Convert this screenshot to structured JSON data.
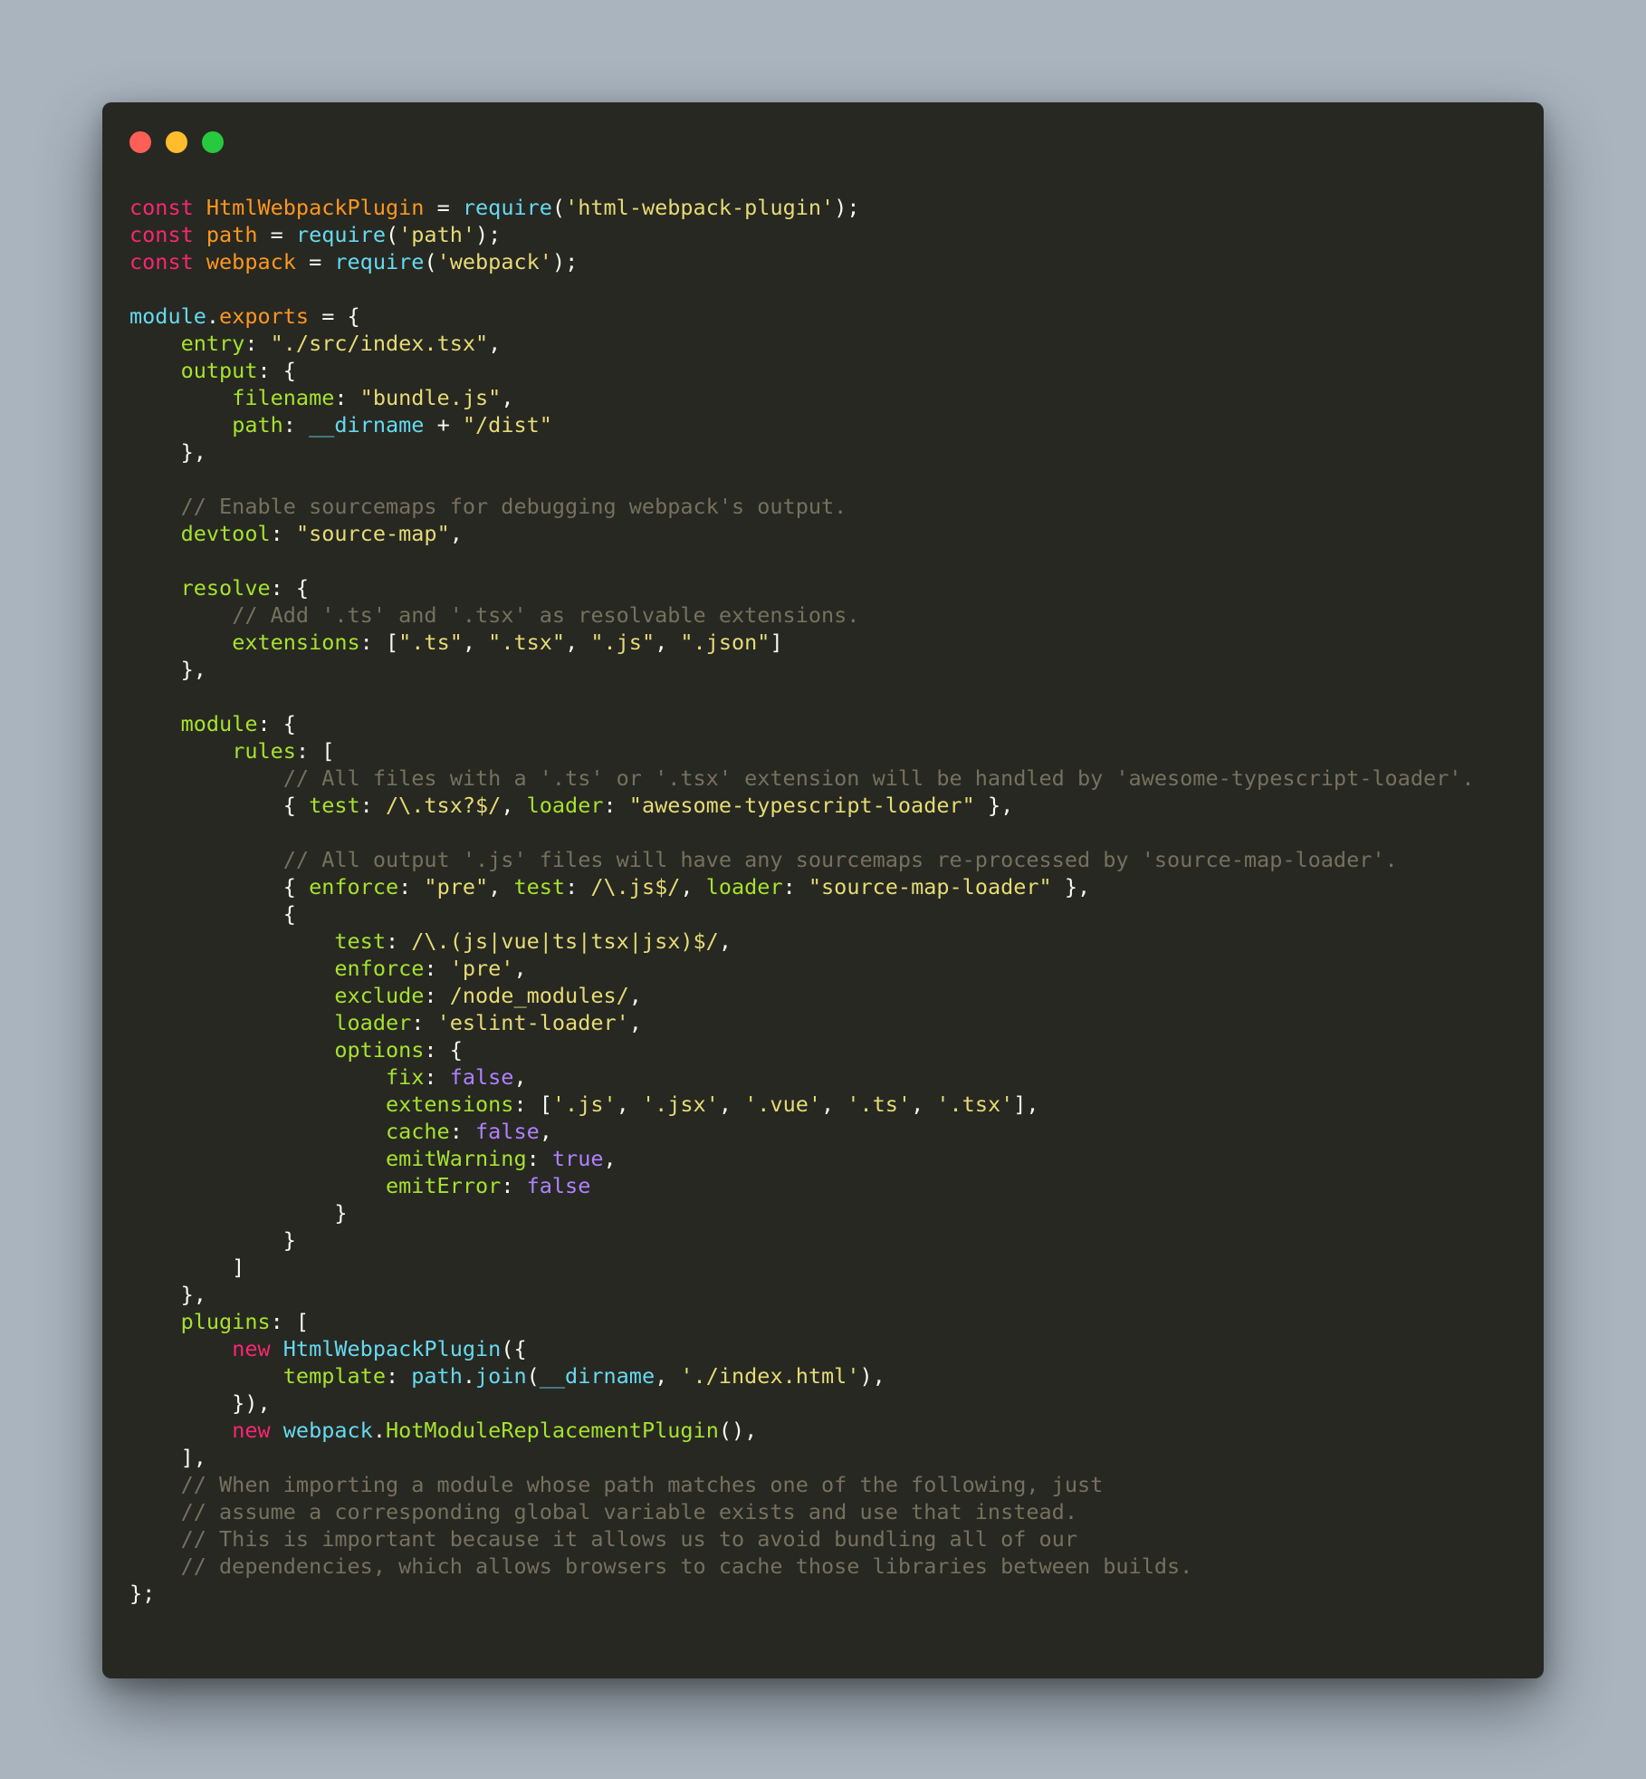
{
  "window": {
    "controls": [
      {
        "name": "close",
        "color": "#ff5f56"
      },
      {
        "name": "minimize",
        "color": "#ffbd2e"
      },
      {
        "name": "zoom",
        "color": "#27c93f"
      }
    ]
  },
  "theme": {
    "background": "#272822",
    "page_background": "#a9b4bf",
    "keyword": "#f92672",
    "variable": "#fd971f",
    "function": "#66d9ef",
    "string": "#e6db74",
    "property": "#a6e22e",
    "comment": "#75715e",
    "boolean": "#ae81ff",
    "text": "#f8f8f2"
  },
  "code": {
    "language": "javascript",
    "lines": [
      [
        [
          "kw",
          "const "
        ],
        [
          "var",
          "HtmlWebpackPlugin"
        ],
        [
          "pun",
          " = "
        ],
        [
          "fn",
          "require"
        ],
        [
          "pun",
          "("
        ],
        [
          "str",
          "'html-webpack-plugin'"
        ],
        [
          "pun",
          ");"
        ]
      ],
      [
        [
          "kw",
          "const "
        ],
        [
          "var",
          "path"
        ],
        [
          "pun",
          " = "
        ],
        [
          "fn",
          "require"
        ],
        [
          "pun",
          "("
        ],
        [
          "str",
          "'path'"
        ],
        [
          "pun",
          ");"
        ]
      ],
      [
        [
          "kw",
          "const "
        ],
        [
          "var",
          "webpack"
        ],
        [
          "pun",
          " = "
        ],
        [
          "fn",
          "require"
        ],
        [
          "pun",
          "("
        ],
        [
          "str",
          "'webpack'"
        ],
        [
          "pun",
          ");"
        ]
      ],
      [],
      [
        [
          "fn",
          "module"
        ],
        [
          "pun",
          "."
        ],
        [
          "var",
          "exports"
        ],
        [
          "pun",
          " = {"
        ]
      ],
      [
        [
          "pun",
          "    "
        ],
        [
          "prop",
          "entry"
        ],
        [
          "pun",
          ": "
        ],
        [
          "str",
          "\"./src/index.tsx\""
        ],
        [
          "pun",
          ","
        ]
      ],
      [
        [
          "pun",
          "    "
        ],
        [
          "prop",
          "output"
        ],
        [
          "pun",
          ": {"
        ]
      ],
      [
        [
          "pun",
          "        "
        ],
        [
          "prop",
          "filename"
        ],
        [
          "pun",
          ": "
        ],
        [
          "str",
          "\"bundle.js\""
        ],
        [
          "pun",
          ","
        ]
      ],
      [
        [
          "pun",
          "        "
        ],
        [
          "prop",
          "path"
        ],
        [
          "pun",
          ": "
        ],
        [
          "fn",
          "__dirname"
        ],
        [
          "pun",
          " + "
        ],
        [
          "str",
          "\"/dist\""
        ]
      ],
      [
        [
          "pun",
          "    },"
        ]
      ],
      [],
      [
        [
          "pun",
          "    "
        ],
        [
          "com",
          "// Enable sourcemaps for debugging webpack's output."
        ]
      ],
      [
        [
          "pun",
          "    "
        ],
        [
          "prop",
          "devtool"
        ],
        [
          "pun",
          ": "
        ],
        [
          "str",
          "\"source-map\""
        ],
        [
          "pun",
          ","
        ]
      ],
      [],
      [
        [
          "pun",
          "    "
        ],
        [
          "prop",
          "resolve"
        ],
        [
          "pun",
          ": {"
        ]
      ],
      [
        [
          "pun",
          "        "
        ],
        [
          "com",
          "// Add '.ts' and '.tsx' as resolvable extensions."
        ]
      ],
      [
        [
          "pun",
          "        "
        ],
        [
          "prop",
          "extensions"
        ],
        [
          "pun",
          ": ["
        ],
        [
          "str",
          "\".ts\""
        ],
        [
          "pun",
          ", "
        ],
        [
          "str",
          "\".tsx\""
        ],
        [
          "pun",
          ", "
        ],
        [
          "str",
          "\".js\""
        ],
        [
          "pun",
          ", "
        ],
        [
          "str",
          "\".json\""
        ],
        [
          "pun",
          "]"
        ]
      ],
      [
        [
          "pun",
          "    },"
        ]
      ],
      [],
      [
        [
          "pun",
          "    "
        ],
        [
          "prop",
          "module"
        ],
        [
          "pun",
          ": {"
        ]
      ],
      [
        [
          "pun",
          "        "
        ],
        [
          "prop",
          "rules"
        ],
        [
          "pun",
          ": ["
        ]
      ],
      [
        [
          "pun",
          "            "
        ],
        [
          "com",
          "// All files with a '.ts' or '.tsx' extension will be handled by 'awesome-typescript-loader'."
        ]
      ],
      [
        [
          "pun",
          "            { "
        ],
        [
          "prop",
          "test"
        ],
        [
          "pun",
          ": "
        ],
        [
          "str",
          "/\\.tsx?$/"
        ],
        [
          "pun",
          ", "
        ],
        [
          "prop",
          "loader"
        ],
        [
          "pun",
          ": "
        ],
        [
          "str",
          "\"awesome-typescript-loader\""
        ],
        [
          "pun",
          " },"
        ]
      ],
      [],
      [
        [
          "pun",
          "            "
        ],
        [
          "com",
          "// All output '.js' files will have any sourcemaps re-processed by 'source-map-loader'."
        ]
      ],
      [
        [
          "pun",
          "            { "
        ],
        [
          "prop",
          "enforce"
        ],
        [
          "pun",
          ": "
        ],
        [
          "str",
          "\"pre\""
        ],
        [
          "pun",
          ", "
        ],
        [
          "prop",
          "test"
        ],
        [
          "pun",
          ": "
        ],
        [
          "str",
          "/\\.js$/"
        ],
        [
          "pun",
          ", "
        ],
        [
          "prop",
          "loader"
        ],
        [
          "pun",
          ": "
        ],
        [
          "str",
          "\"source-map-loader\""
        ],
        [
          "pun",
          " },"
        ]
      ],
      [
        [
          "pun",
          "            {"
        ]
      ],
      [
        [
          "pun",
          "                "
        ],
        [
          "prop",
          "test"
        ],
        [
          "pun",
          ": "
        ],
        [
          "str",
          "/\\.(js|vue|ts|tsx|jsx)$/"
        ],
        [
          "pun",
          ","
        ]
      ],
      [
        [
          "pun",
          "                "
        ],
        [
          "prop",
          "enforce"
        ],
        [
          "pun",
          ": "
        ],
        [
          "str",
          "'pre'"
        ],
        [
          "pun",
          ","
        ]
      ],
      [
        [
          "pun",
          "                "
        ],
        [
          "prop",
          "exclude"
        ],
        [
          "pun",
          ": "
        ],
        [
          "str",
          "/node_modules/"
        ],
        [
          "pun",
          ","
        ]
      ],
      [
        [
          "pun",
          "                "
        ],
        [
          "prop",
          "loader"
        ],
        [
          "pun",
          ": "
        ],
        [
          "str",
          "'eslint-loader'"
        ],
        [
          "pun",
          ","
        ]
      ],
      [
        [
          "pun",
          "                "
        ],
        [
          "prop",
          "options"
        ],
        [
          "pun",
          ": {"
        ]
      ],
      [
        [
          "pun",
          "                    "
        ],
        [
          "prop",
          "fix"
        ],
        [
          "pun",
          ": "
        ],
        [
          "bool",
          "false"
        ],
        [
          "pun",
          ","
        ]
      ],
      [
        [
          "pun",
          "                    "
        ],
        [
          "prop",
          "extensions"
        ],
        [
          "pun",
          ": ["
        ],
        [
          "str",
          "'.js'"
        ],
        [
          "pun",
          ", "
        ],
        [
          "str",
          "'.jsx'"
        ],
        [
          "pun",
          ", "
        ],
        [
          "str",
          "'.vue'"
        ],
        [
          "pun",
          ", "
        ],
        [
          "str",
          "'.ts'"
        ],
        [
          "pun",
          ", "
        ],
        [
          "str",
          "'.tsx'"
        ],
        [
          "pun",
          "],"
        ]
      ],
      [
        [
          "pun",
          "                    "
        ],
        [
          "prop",
          "cache"
        ],
        [
          "pun",
          ": "
        ],
        [
          "bool",
          "false"
        ],
        [
          "pun",
          ","
        ]
      ],
      [
        [
          "pun",
          "                    "
        ],
        [
          "prop",
          "emitWarning"
        ],
        [
          "pun",
          ": "
        ],
        [
          "bool",
          "true"
        ],
        [
          "pun",
          ","
        ]
      ],
      [
        [
          "pun",
          "                    "
        ],
        [
          "prop",
          "emitError"
        ],
        [
          "pun",
          ": "
        ],
        [
          "bool",
          "false"
        ]
      ],
      [
        [
          "pun",
          "                }"
        ]
      ],
      [
        [
          "pun",
          "            }"
        ]
      ],
      [
        [
          "pun",
          "        ]"
        ]
      ],
      [
        [
          "pun",
          "    },"
        ]
      ],
      [
        [
          "pun",
          "    "
        ],
        [
          "prop",
          "plugins"
        ],
        [
          "pun",
          ": ["
        ]
      ],
      [
        [
          "pun",
          "        "
        ],
        [
          "kw",
          "new "
        ],
        [
          "fn",
          "HtmlWebpackPlugin"
        ],
        [
          "pun",
          "({"
        ]
      ],
      [
        [
          "pun",
          "            "
        ],
        [
          "prop",
          "template"
        ],
        [
          "pun",
          ": "
        ],
        [
          "fn",
          "path"
        ],
        [
          "pun",
          "."
        ],
        [
          "fn",
          "join"
        ],
        [
          "pun",
          "("
        ],
        [
          "fn",
          "__dirname"
        ],
        [
          "pun",
          ", "
        ],
        [
          "str",
          "'./index.html'"
        ],
        [
          "pun",
          "),"
        ]
      ],
      [
        [
          "pun",
          "        }),"
        ]
      ],
      [
        [
          "pun",
          "        "
        ],
        [
          "kw",
          "new "
        ],
        [
          "fn",
          "webpack"
        ],
        [
          "pun",
          "."
        ],
        [
          "prop",
          "HotModuleReplacementPlugin"
        ],
        [
          "pun",
          "(),"
        ]
      ],
      [
        [
          "pun",
          "    ],"
        ]
      ],
      [
        [
          "pun",
          "    "
        ],
        [
          "com",
          "// When importing a module whose path matches one of the following, just"
        ]
      ],
      [
        [
          "pun",
          "    "
        ],
        [
          "com",
          "// assume a corresponding global variable exists and use that instead."
        ]
      ],
      [
        [
          "pun",
          "    "
        ],
        [
          "com",
          "// This is important because it allows us to avoid bundling all of our"
        ]
      ],
      [
        [
          "pun",
          "    "
        ],
        [
          "com",
          "// dependencies, which allows browsers to cache those libraries between builds."
        ]
      ],
      [
        [
          "pun",
          "};"
        ]
      ]
    ]
  }
}
